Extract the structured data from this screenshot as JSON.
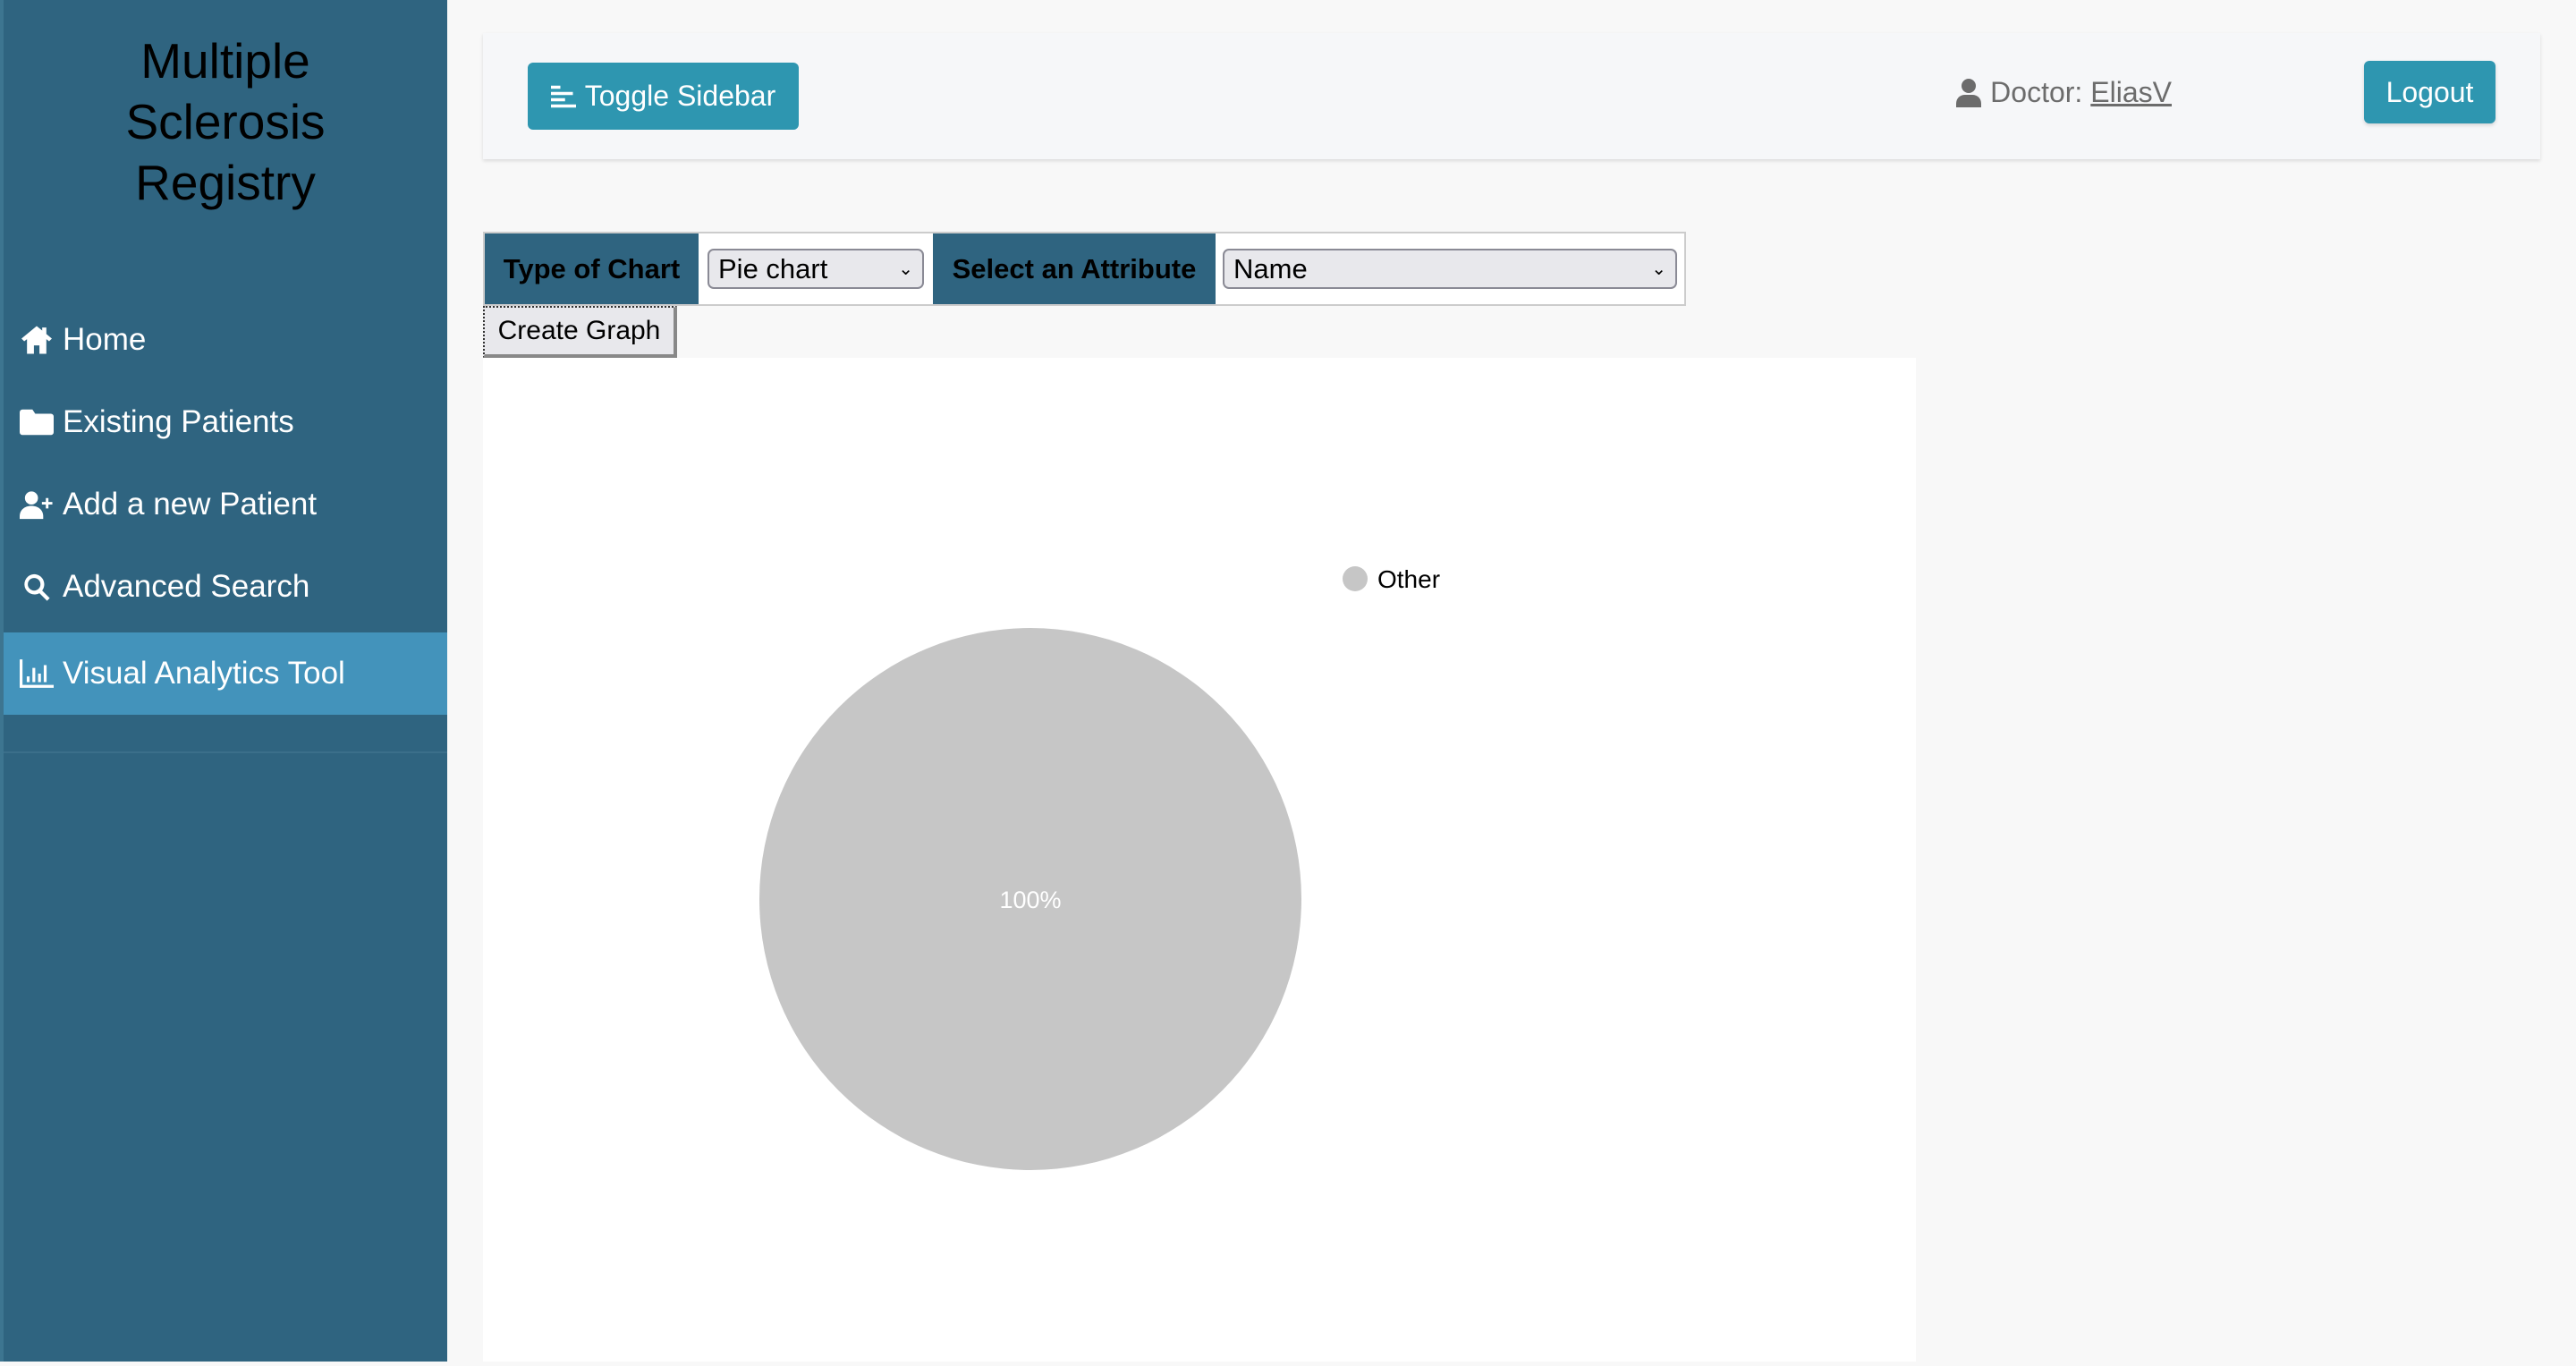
{
  "sidebar": {
    "title": "Multiple Sclerosis Registry",
    "items": [
      {
        "label": "Home",
        "icon": "home-icon"
      },
      {
        "label": "Existing Patients",
        "icon": "folder-icon"
      },
      {
        "label": "Add a new Patient",
        "icon": "user-plus-icon"
      },
      {
        "label": "Advanced Search",
        "icon": "search-icon"
      },
      {
        "label": "Visual Analytics Tool",
        "icon": "chart-bar-icon",
        "active": true
      }
    ]
  },
  "header": {
    "toggle_label": "Toggle Sidebar",
    "doctor_label": "Doctor:",
    "doctor_name": "EliasV",
    "logout_label": "Logout"
  },
  "form": {
    "chart_type_label": "Type of Chart",
    "chart_type_value": "Pie chart",
    "attribute_label": "Select an Attribute",
    "attribute_value": "Name",
    "create_label": "Create Graph"
  },
  "colors": {
    "sidebar": "#2f6480",
    "active": "#4393bb",
    "button": "#2e96b0",
    "slice": "#c6c6c6"
  },
  "chart_data": {
    "type": "pie",
    "labels": [
      "Other"
    ],
    "values": [
      100
    ],
    "data_labels": [
      "100%"
    ],
    "colors": [
      "#c6c6c6"
    ],
    "legend": "top-right"
  }
}
